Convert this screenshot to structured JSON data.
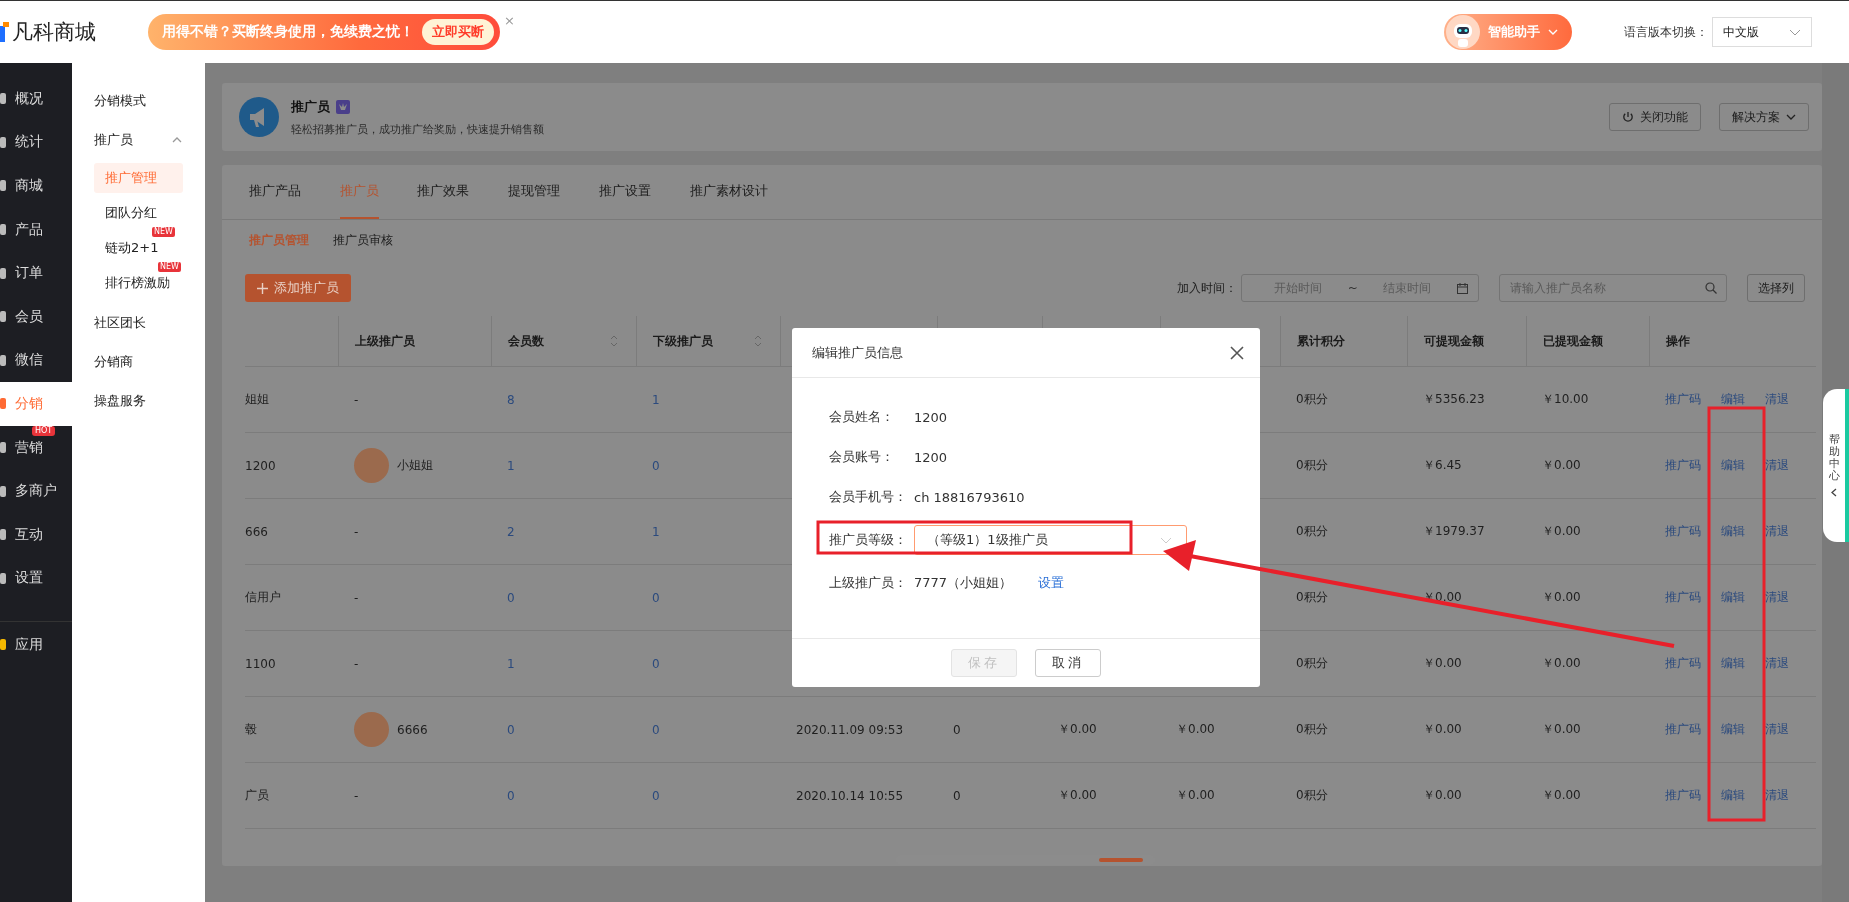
{
  "topbar": {
    "logo": "凡科商城",
    "promo": {
      "text": "用得不错？买断终身使用，免续费之忧！",
      "button": "立即买断",
      "close": "×"
    },
    "assistant": "智能助手",
    "language_label": "语言版本切换：",
    "language_value": "中文版"
  },
  "nav": [
    {
      "label": "概况",
      "selected": false
    },
    {
      "label": "统计",
      "selected": false
    },
    {
      "label": "商城",
      "selected": false
    },
    {
      "label": "产品",
      "selected": false
    },
    {
      "label": "订单",
      "selected": false
    },
    {
      "label": "会员",
      "selected": false
    },
    {
      "label": "微信",
      "selected": false
    },
    {
      "label": "分销",
      "selected": true
    },
    {
      "label": "营销",
      "selected": false,
      "badge": "HOT"
    },
    {
      "label": "多商户",
      "selected": false
    },
    {
      "label": "互动",
      "selected": false
    },
    {
      "label": "设置",
      "selected": false
    },
    {
      "label": "应用",
      "selected": false,
      "kind": "apps"
    }
  ],
  "subnav": [
    {
      "label": "分销模式"
    },
    {
      "label": "推广员",
      "expanded": true,
      "children": [
        {
          "label": "推广管理",
          "selected": true
        },
        {
          "label": "团队分红",
          "selected": false
        },
        {
          "label": "链动2+1",
          "selected": false,
          "badge": "NEW"
        },
        {
          "label": "排行榜激励",
          "selected": false,
          "badge": "NEW"
        }
      ]
    },
    {
      "label": "社区团长"
    },
    {
      "label": "分销商"
    },
    {
      "label": "操盘服务"
    }
  ],
  "header": {
    "title": "推广员",
    "subtitle": "轻松招募推广员，成功推广给奖励，快速提升销售额",
    "buttons": [
      {
        "kind": "power",
        "label": "关闭功能"
      },
      {
        "kind": "dropdown",
        "label": "解决方案"
      }
    ]
  },
  "tabs": [
    {
      "label": "推广产品",
      "selected": false
    },
    {
      "label": "推广员",
      "selected": true
    },
    {
      "label": "推广效果",
      "selected": false
    },
    {
      "label": "提现管理",
      "selected": false
    },
    {
      "label": "推广设置",
      "selected": false
    },
    {
      "label": "推广素材设计",
      "selected": false
    }
  ],
  "subtabs": [
    {
      "label": "推广员管理",
      "selected": true
    },
    {
      "label": "推广员审核",
      "selected": false
    }
  ],
  "toolbar": {
    "add_button": "添加推广员",
    "date_label": "加入时间：",
    "start_placeholder": "开始时间",
    "separator": "~",
    "end_placeholder": "结束时间",
    "search_placeholder": "请输入推广员名称",
    "columns_button": "选择列"
  },
  "table": {
    "columns": [
      null,
      {
        "label": "上级推广员"
      },
      {
        "label": "会员数",
        "sortable": true
      },
      {
        "label": "下级推广员",
        "sortable": true
      },
      null,
      null,
      null,
      null,
      {
        "label": "累计积分"
      },
      {
        "label": "可提现金额"
      },
      {
        "label": "已提现金额"
      },
      {
        "label": "操作"
      }
    ],
    "rows": [
      {
        "column_1": "姐姐",
        "parent": "-",
        "members": "8",
        "subordinates": "1",
        "points": "0积分",
        "withdrawable": "￥5356.23",
        "withdrawn": "￥10.00",
        "actions": [
          "推广码",
          "编辑",
          "清退"
        ]
      },
      {
        "column_1": "1200",
        "parent": "小姐姐",
        "parent_avatar": true,
        "members": "1",
        "subordinates": "0",
        "points": "0积分",
        "withdrawable": "￥6.45",
        "withdrawn": "￥0.00",
        "actions": [
          "推广码",
          "编辑",
          "清退"
        ]
      },
      {
        "column_1": "666",
        "parent": "-",
        "members": "2",
        "subordinates": "1",
        "points": "0积分",
        "withdrawable": "￥1979.37",
        "withdrawn": "￥0.00",
        "actions": [
          "推广码",
          "编辑",
          "清退"
        ]
      },
      {
        "column_1": "信用户",
        "parent": "-",
        "members": "0",
        "subordinates": "0",
        "points": "0积分",
        "withdrawable": "￥0.00",
        "withdrawn": "￥0.00",
        "actions": [
          "推广码",
          "编辑",
          "清退"
        ]
      },
      {
        "column_1": "1100",
        "parent": "-",
        "members": "1",
        "subordinates": "0",
        "points": "0积分",
        "withdrawable": "￥0.00",
        "withdrawn": "￥0.00",
        "actions": [
          "推广码",
          "编辑",
          "清退"
        ]
      },
      {
        "column_1": "毂",
        "parent": "6666",
        "parent_avatar": true,
        "members": "0",
        "subordinates": "0",
        "column_5": "2020.11.09 09:53",
        "column_6": "0",
        "column_7": "￥0.00",
        "column_8": "￥0.00",
        "points": "0积分",
        "withdrawable": "￥0.00",
        "withdrawn": "￥0.00",
        "actions": [
          "推广码",
          "编辑",
          "清退"
        ]
      },
      {
        "column_1": "广员",
        "parent": "-",
        "members": "0",
        "subordinates": "0",
        "column_5": "2020.10.14 10:55",
        "column_6": "0",
        "column_7": "￥0.00",
        "column_8": "￥0.00",
        "points": "0积分",
        "withdrawable": "￥0.00",
        "withdrawn": "￥0.00",
        "actions": [
          "推广码",
          "编辑",
          "清退"
        ]
      }
    ]
  },
  "modal": {
    "title": "编辑推广员信息",
    "fields": [
      {
        "kind": "text",
        "label": "会员姓名：",
        "value": "1200"
      },
      {
        "kind": "text",
        "label": "会员账号：",
        "value": "1200"
      },
      {
        "kind": "text",
        "label": "会员手机号：",
        "value": "ch 18816793610"
      },
      {
        "kind": "select",
        "label": "推广员等级：",
        "value": "（等级1）1级推广员"
      },
      {
        "kind": "link",
        "label": "上级推广员：",
        "value": "7777（小姐姐）",
        "link": "设置"
      }
    ],
    "buttons": [
      {
        "label": "保存",
        "disabled": true
      },
      {
        "label": "取消",
        "disabled": false
      }
    ]
  },
  "help": "帮助中心"
}
